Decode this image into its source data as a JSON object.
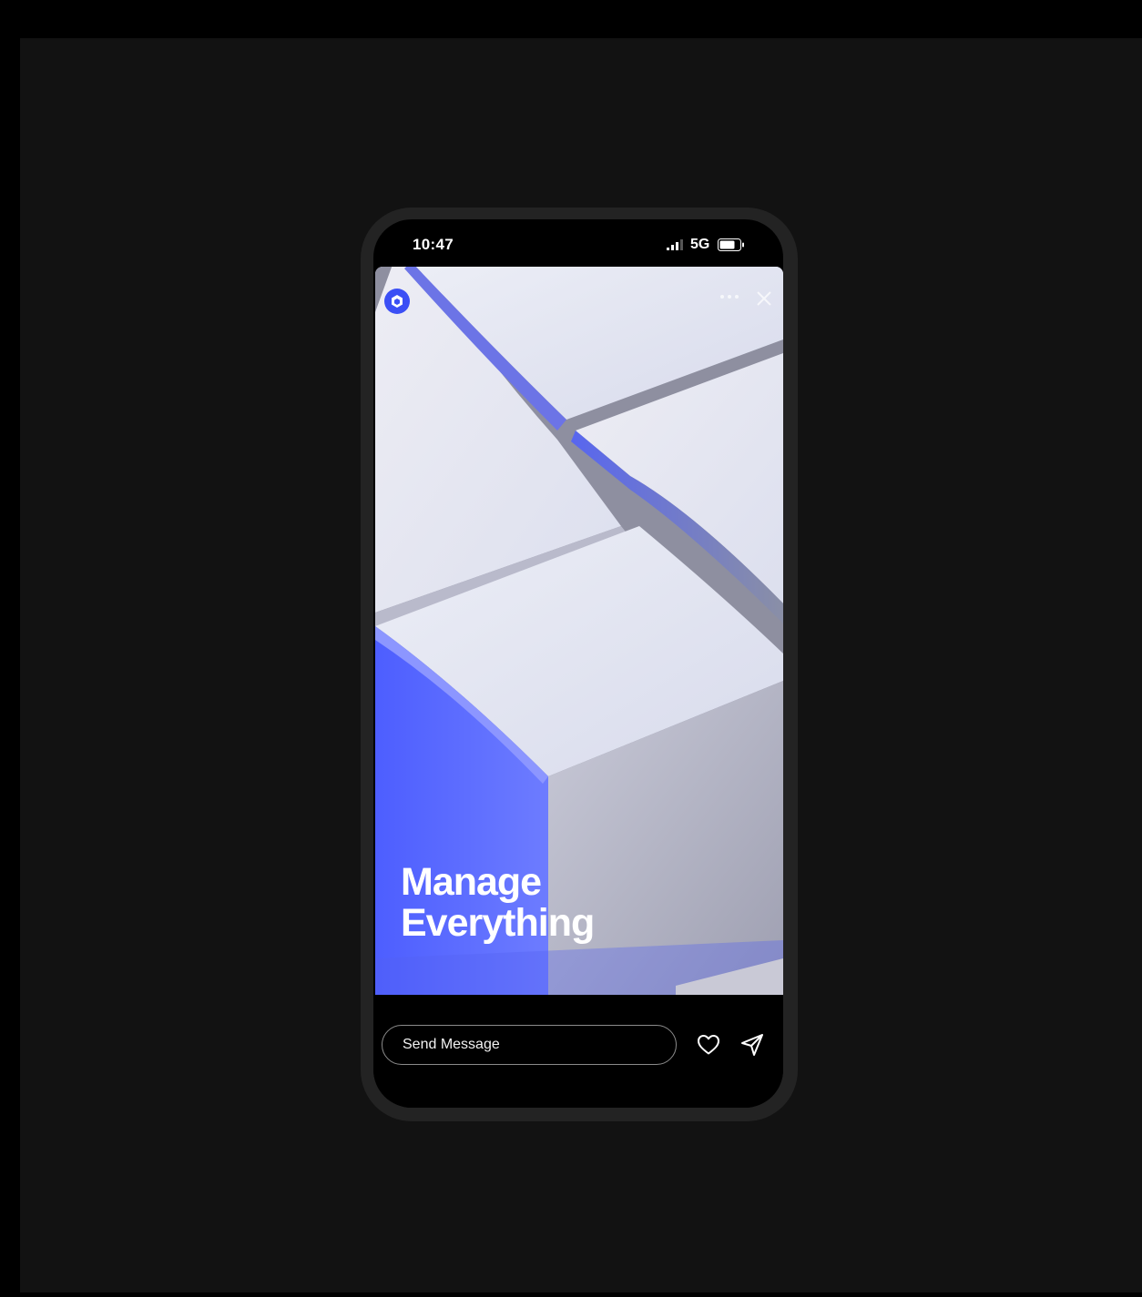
{
  "status_bar": {
    "time": "10:47",
    "network": "5G"
  },
  "story": {
    "headline_line1": "Manage",
    "headline_line2": "Everything",
    "accent_color": "#5a6cff"
  },
  "footer": {
    "message_placeholder": "Send Message"
  },
  "icons": {
    "brand": "brand-logo-icon",
    "more": "more-icon",
    "close": "close-icon",
    "like": "heart-icon",
    "share": "send-icon",
    "signal": "signal-icon",
    "battery": "battery-icon"
  }
}
